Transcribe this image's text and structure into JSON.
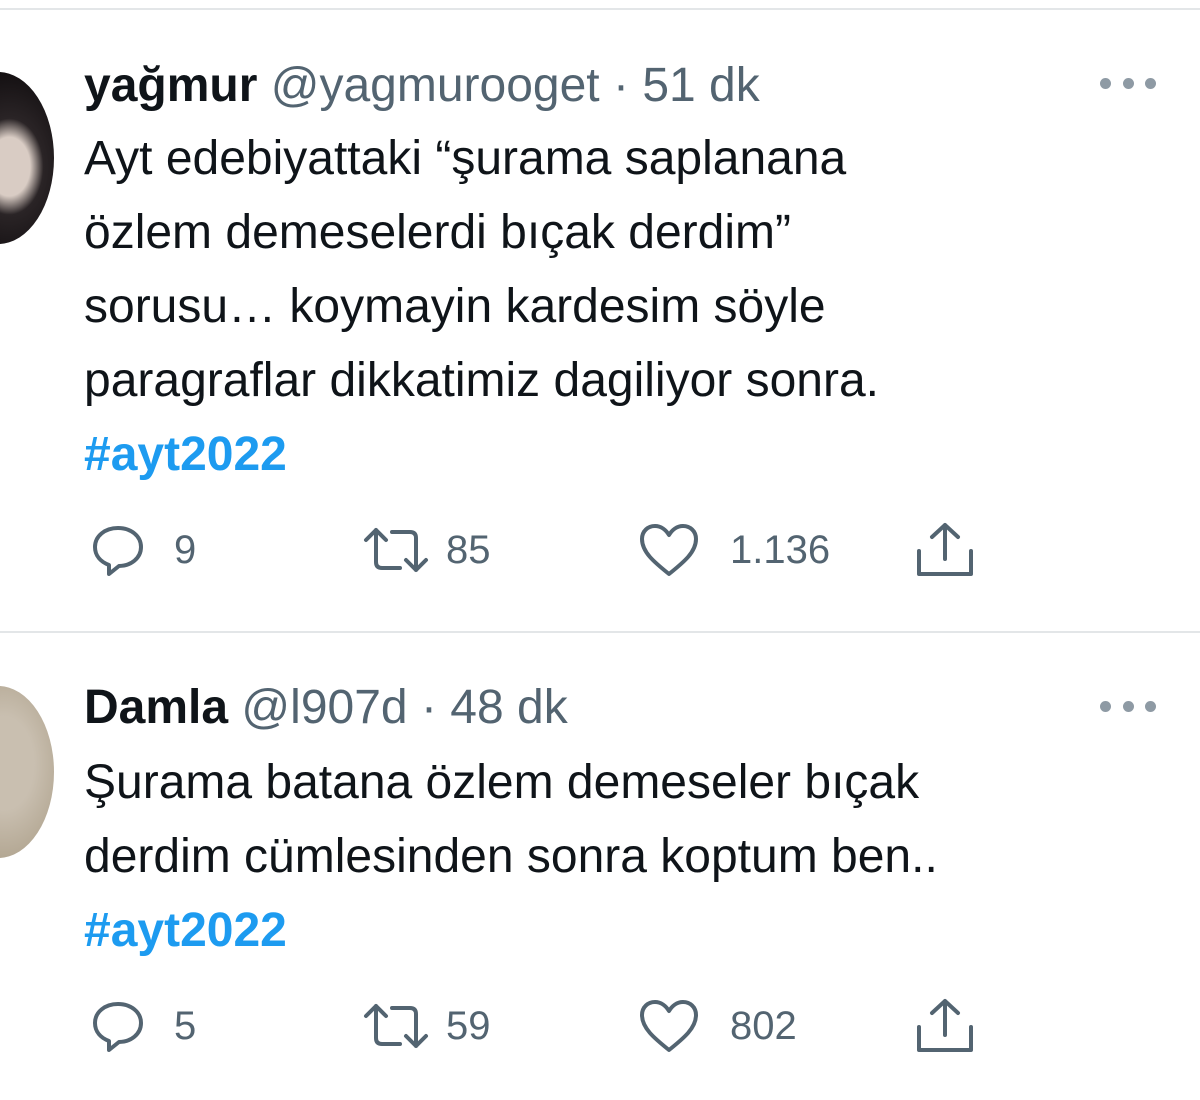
{
  "tweets": [
    {
      "name": "yağmur",
      "handle": "@yagmurooget",
      "separator": "·",
      "time": "51 dk",
      "text_lines": [
        "Ayt edebiyattaki “şurama saplanana",
        "özlem demeselerdi bıçak derdim”",
        "sorusu… koymayin kardesim söyle",
        "paragraflar dikkatimiz dagiliyor sonra."
      ],
      "hashtag": "#ayt2022",
      "replies": "9",
      "retweets": "85",
      "likes": "1.136"
    },
    {
      "name": "Damla",
      "handle": "@l907d",
      "separator": "·",
      "time": "48 dk",
      "text_lines": [
        "Şurama batana özlem demeseler bıçak",
        "derdim cümlesinden sonra koptum ben.."
      ],
      "hashtag": "#ayt2022",
      "replies": "5",
      "retweets": "59",
      "likes": "802"
    }
  ],
  "icons": {
    "reply": "reply-bubble-icon",
    "retweet": "retweet-icon",
    "like": "heart-icon",
    "share": "share-upload-icon",
    "more": "more-dots-icon"
  },
  "colors": {
    "text": "#0f1419",
    "secondary": "#536471",
    "hashtag": "#1d9bf0",
    "divider": "#e3e6e8"
  }
}
